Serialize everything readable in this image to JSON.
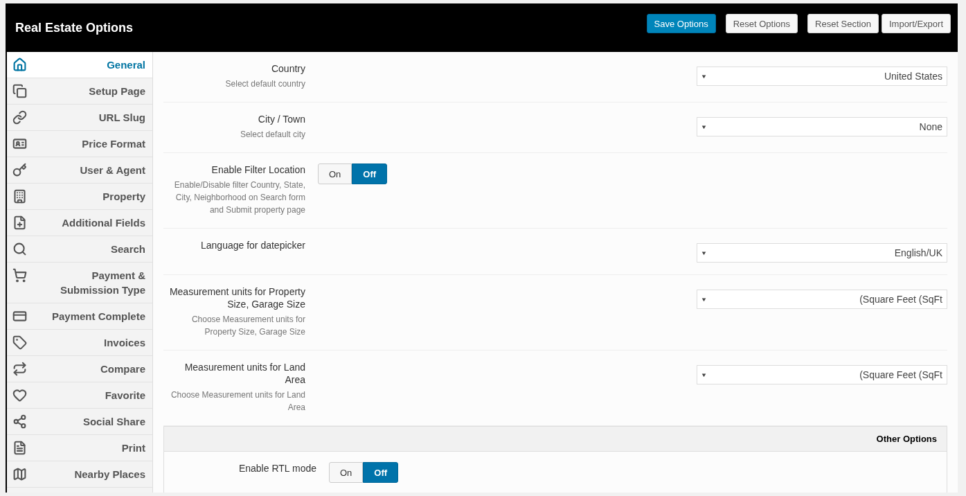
{
  "header": {
    "title": "Real Estate Options",
    "buttons": [
      {
        "label": "Save Options",
        "kind": "primary"
      },
      {
        "label": "Reset Options",
        "kind": "default"
      },
      {
        "label": "Reset Section",
        "kind": "default"
      },
      {
        "label": "Import/Export",
        "kind": "default"
      }
    ]
  },
  "sidebar": {
    "items": [
      {
        "label": "General",
        "selected": true
      },
      {
        "label": "Setup Page",
        "selected": false
      },
      {
        "label": "URL Slug",
        "selected": false
      },
      {
        "label": "Price Format",
        "selected": false
      },
      {
        "label": "User & Agent",
        "selected": false
      },
      {
        "label": "Property",
        "selected": false
      },
      {
        "label": "Additional Fields",
        "selected": false
      },
      {
        "label": "Search",
        "selected": false
      },
      {
        "label": "Payment & Submission Type",
        "selected": false
      },
      {
        "label": "Payment Complete",
        "selected": false
      },
      {
        "label": "Invoices",
        "selected": false
      },
      {
        "label": "Compare",
        "selected": false
      },
      {
        "label": "Favorite",
        "selected": false
      },
      {
        "label": "Social Share",
        "selected": false
      },
      {
        "label": "Print",
        "selected": false
      },
      {
        "label": "Nearby Places",
        "selected": false
      }
    ]
  },
  "settings": [
    {
      "kind": "select",
      "label": "Country",
      "description": "Select default country",
      "value": "United States"
    },
    {
      "kind": "select",
      "label": "City / Town",
      "description": "Select default city",
      "value": "None"
    },
    {
      "kind": "toggle",
      "label": "Enable Filter Location",
      "description": "Enable/Disable filter Country, State, City, Neighborhood on Search form and Submit property page",
      "options": [
        {
          "label": "On",
          "selected": false
        },
        {
          "label": "Off",
          "selected": true
        }
      ]
    },
    {
      "kind": "select",
      "label": "Language for datepicker",
      "value": "English/UK"
    },
    {
      "kind": "select",
      "label": "Measurement units for Property Size, Garage Size",
      "description": "Choose Measurement units for Property Size, Garage Size",
      "value": "(Square Feet (SqFt"
    },
    {
      "kind": "select",
      "label": "Measurement units for Land Area",
      "description": "Choose Measurement units for Land Area",
      "value": "(Square Feet (SqFt"
    }
  ],
  "section": {
    "title": "Other Options",
    "settings": [
      {
        "kind": "toggle",
        "label": "Enable RTL mode",
        "options": [
          {
            "label": "On",
            "selected": false
          },
          {
            "label": "Off",
            "selected": true
          }
        ]
      }
    ]
  }
}
